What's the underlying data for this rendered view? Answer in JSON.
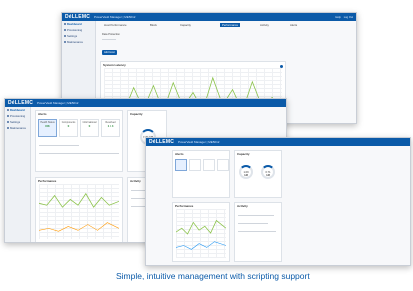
{
  "brand": {
    "logo": "DéLLEMC",
    "accent": "#0b5aa8"
  },
  "windows": {
    "back": {
      "app_title": "PowerVault Manager | ME5012",
      "header_links": [
        "Help",
        "Log Out"
      ],
      "sidebar": [
        "Dashboard",
        "Provisioning",
        "Settings",
        "Maintenance"
      ],
      "tabs": [
        "Host Performance",
        "Block",
        "Capacity",
        "Performance",
        "Activity",
        "Alerts"
      ],
      "panel_label": "Data Protection",
      "button_label": "Add Host",
      "chart_title": "System Latency"
    },
    "middle": {
      "app_title": "PowerVault Manager | ME5012",
      "sidebar": [
        "Dashboard",
        "Provisioning",
        "Settings",
        "Maintenance"
      ],
      "alerts_title": "Alerts",
      "capacity_title": "Capacity",
      "tiles": [
        {
          "label": "Health Status",
          "value": "OK"
        },
        {
          "label": "Components",
          "value": "0"
        },
        {
          "label": "Informational",
          "value": "0"
        },
        {
          "label": "Resolved",
          "value": "1 / 4"
        }
      ],
      "gauge_value": "7.26 GiB",
      "performance_title": "Performance",
      "activity_title": "Activity"
    },
    "front": {
      "app_title": "PowerVault Manager | ME5012",
      "alerts_title": "Alerts",
      "capacity_title": "Capacity",
      "gauge_values": [
        "1.09 GiB",
        "0.71 GiB"
      ],
      "performance_title": "Performance",
      "activity_title": "Activity"
    }
  },
  "caption": "Simple, intuitive management with scripting support"
}
